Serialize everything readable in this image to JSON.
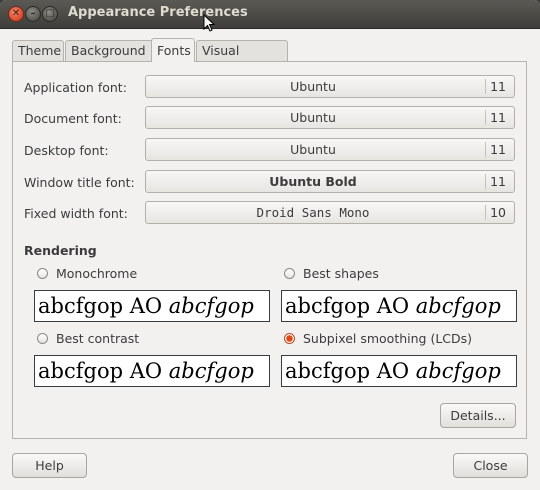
{
  "window": {
    "title": "Appearance Preferences"
  },
  "tabs": [
    {
      "label": "Theme"
    },
    {
      "label": "Background"
    },
    {
      "label": "Fonts"
    },
    {
      "label": "Visual Effects"
    }
  ],
  "active_tab": "Fonts",
  "fonts": [
    {
      "label": "Application font:",
      "font": "Ubuntu",
      "size": "11"
    },
    {
      "label": "Document font:",
      "font": "Ubuntu",
      "size": "11"
    },
    {
      "label": "Desktop font:",
      "font": "Ubuntu",
      "size": "11"
    },
    {
      "label": "Window title font:",
      "font": "Ubuntu Bold",
      "size": "11"
    },
    {
      "label": "Fixed width font:",
      "font": "Droid Sans Mono",
      "size": "10"
    }
  ],
  "rendering": {
    "heading": "Rendering",
    "options": [
      {
        "label": "Monochrome",
        "checked": false
      },
      {
        "label": "Best shapes",
        "checked": false
      },
      {
        "label": "Best contrast",
        "checked": false
      },
      {
        "label": "Subpixel smoothing (LCDs)",
        "checked": true
      }
    ],
    "preview_regular": "abcfgop AO ",
    "preview_italic": "abcfgop"
  },
  "buttons": {
    "details": "Details...",
    "help": "Help",
    "close": "Close"
  },
  "colors": {
    "accent": "#dd4814",
    "titlebar": "#3c3b37"
  }
}
